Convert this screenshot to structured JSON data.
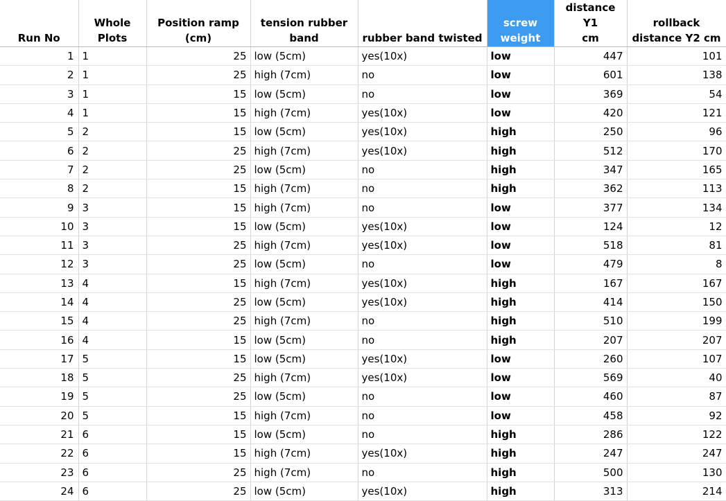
{
  "table": {
    "columns": [
      {
        "key": "run",
        "label": "Run No",
        "align": "num",
        "selected": false
      },
      {
        "key": "whole_plots",
        "label": "Whole\nPlots",
        "align": "txt",
        "selected": false
      },
      {
        "key": "position_ramp",
        "label": "Position ramp\n(cm)",
        "align": "num",
        "selected": false
      },
      {
        "key": "tension",
        "label": "tension rubber\nband",
        "align": "txt",
        "selected": false
      },
      {
        "key": "twisted",
        "label": "rubber band twisted",
        "align": "txt",
        "selected": false
      },
      {
        "key": "screw_weight",
        "label": "screw\nweight",
        "align": "txt",
        "bold": true,
        "selected": true
      },
      {
        "key": "y1",
        "label": "distance Y1\ncm",
        "align": "num",
        "selected": false
      },
      {
        "key": "y2",
        "label": "rollback\ndistance Y2 cm",
        "align": "num",
        "selected": false
      }
    ],
    "rows": [
      [
        "1",
        "1",
        "25",
        "low (5cm)",
        "yes(10x)",
        "low",
        "447",
        "101"
      ],
      [
        "2",
        "1",
        "25",
        "high (7cm)",
        "no",
        "low",
        "601",
        "138"
      ],
      [
        "3",
        "1",
        "15",
        "low (5cm)",
        "no",
        "low",
        "369",
        "54"
      ],
      [
        "4",
        "1",
        "15",
        "high (7cm)",
        "yes(10x)",
        "low",
        "420",
        "121"
      ],
      [
        "5",
        "2",
        "15",
        "low (5cm)",
        "yes(10x)",
        "high",
        "250",
        "96"
      ],
      [
        "6",
        "2",
        "25",
        "high (7cm)",
        "yes(10x)",
        "high",
        "512",
        "170"
      ],
      [
        "7",
        "2",
        "25",
        "low (5cm)",
        "no",
        "high",
        "347",
        "165"
      ],
      [
        "8",
        "2",
        "15",
        "high (7cm)",
        "no",
        "high",
        "362",
        "113"
      ],
      [
        "9",
        "3",
        "15",
        "high (7cm)",
        "no",
        "low",
        "377",
        "134"
      ],
      [
        "10",
        "3",
        "15",
        "low (5cm)",
        "yes(10x)",
        "low",
        "124",
        "12"
      ],
      [
        "11",
        "3",
        "25",
        "high (7cm)",
        "yes(10x)",
        "low",
        "518",
        "81"
      ],
      [
        "12",
        "3",
        "25",
        "low (5cm)",
        "no",
        "low",
        "479",
        "8"
      ],
      [
        "13",
        "4",
        "15",
        "high (7cm)",
        "yes(10x)",
        "high",
        "167",
        "167"
      ],
      [
        "14",
        "4",
        "25",
        "low (5cm)",
        "yes(10x)",
        "high",
        "414",
        "150"
      ],
      [
        "15",
        "4",
        "25",
        "high (7cm)",
        "no",
        "high",
        "510",
        "199"
      ],
      [
        "16",
        "4",
        "15",
        "low (5cm)",
        "no",
        "high",
        "207",
        "207"
      ],
      [
        "17",
        "5",
        "15",
        "low (5cm)",
        "yes(10x)",
        "low",
        "260",
        "107"
      ],
      [
        "18",
        "5",
        "25",
        "high (7cm)",
        "yes(10x)",
        "low",
        "569",
        "40"
      ],
      [
        "19",
        "5",
        "25",
        "low (5cm)",
        "no",
        "low",
        "460",
        "87"
      ],
      [
        "20",
        "5",
        "15",
        "high (7cm)",
        "no",
        "low",
        "458",
        "92"
      ],
      [
        "21",
        "6",
        "15",
        "low (5cm)",
        "no",
        "high",
        "286",
        "122"
      ],
      [
        "22",
        "6",
        "15",
        "high (7cm)",
        "yes(10x)",
        "high",
        "247",
        "247"
      ],
      [
        "23",
        "6",
        "25",
        "high (7cm)",
        "no",
        "high",
        "500",
        "130"
      ],
      [
        "24",
        "6",
        "25",
        "low (5cm)",
        "yes(10x)",
        "high",
        "313",
        "214"
      ]
    ]
  },
  "colors": {
    "selected_header_bg": "#3d9bf0",
    "selected_header_text": "#ffffff",
    "grid_line": "#d4d4d4"
  }
}
